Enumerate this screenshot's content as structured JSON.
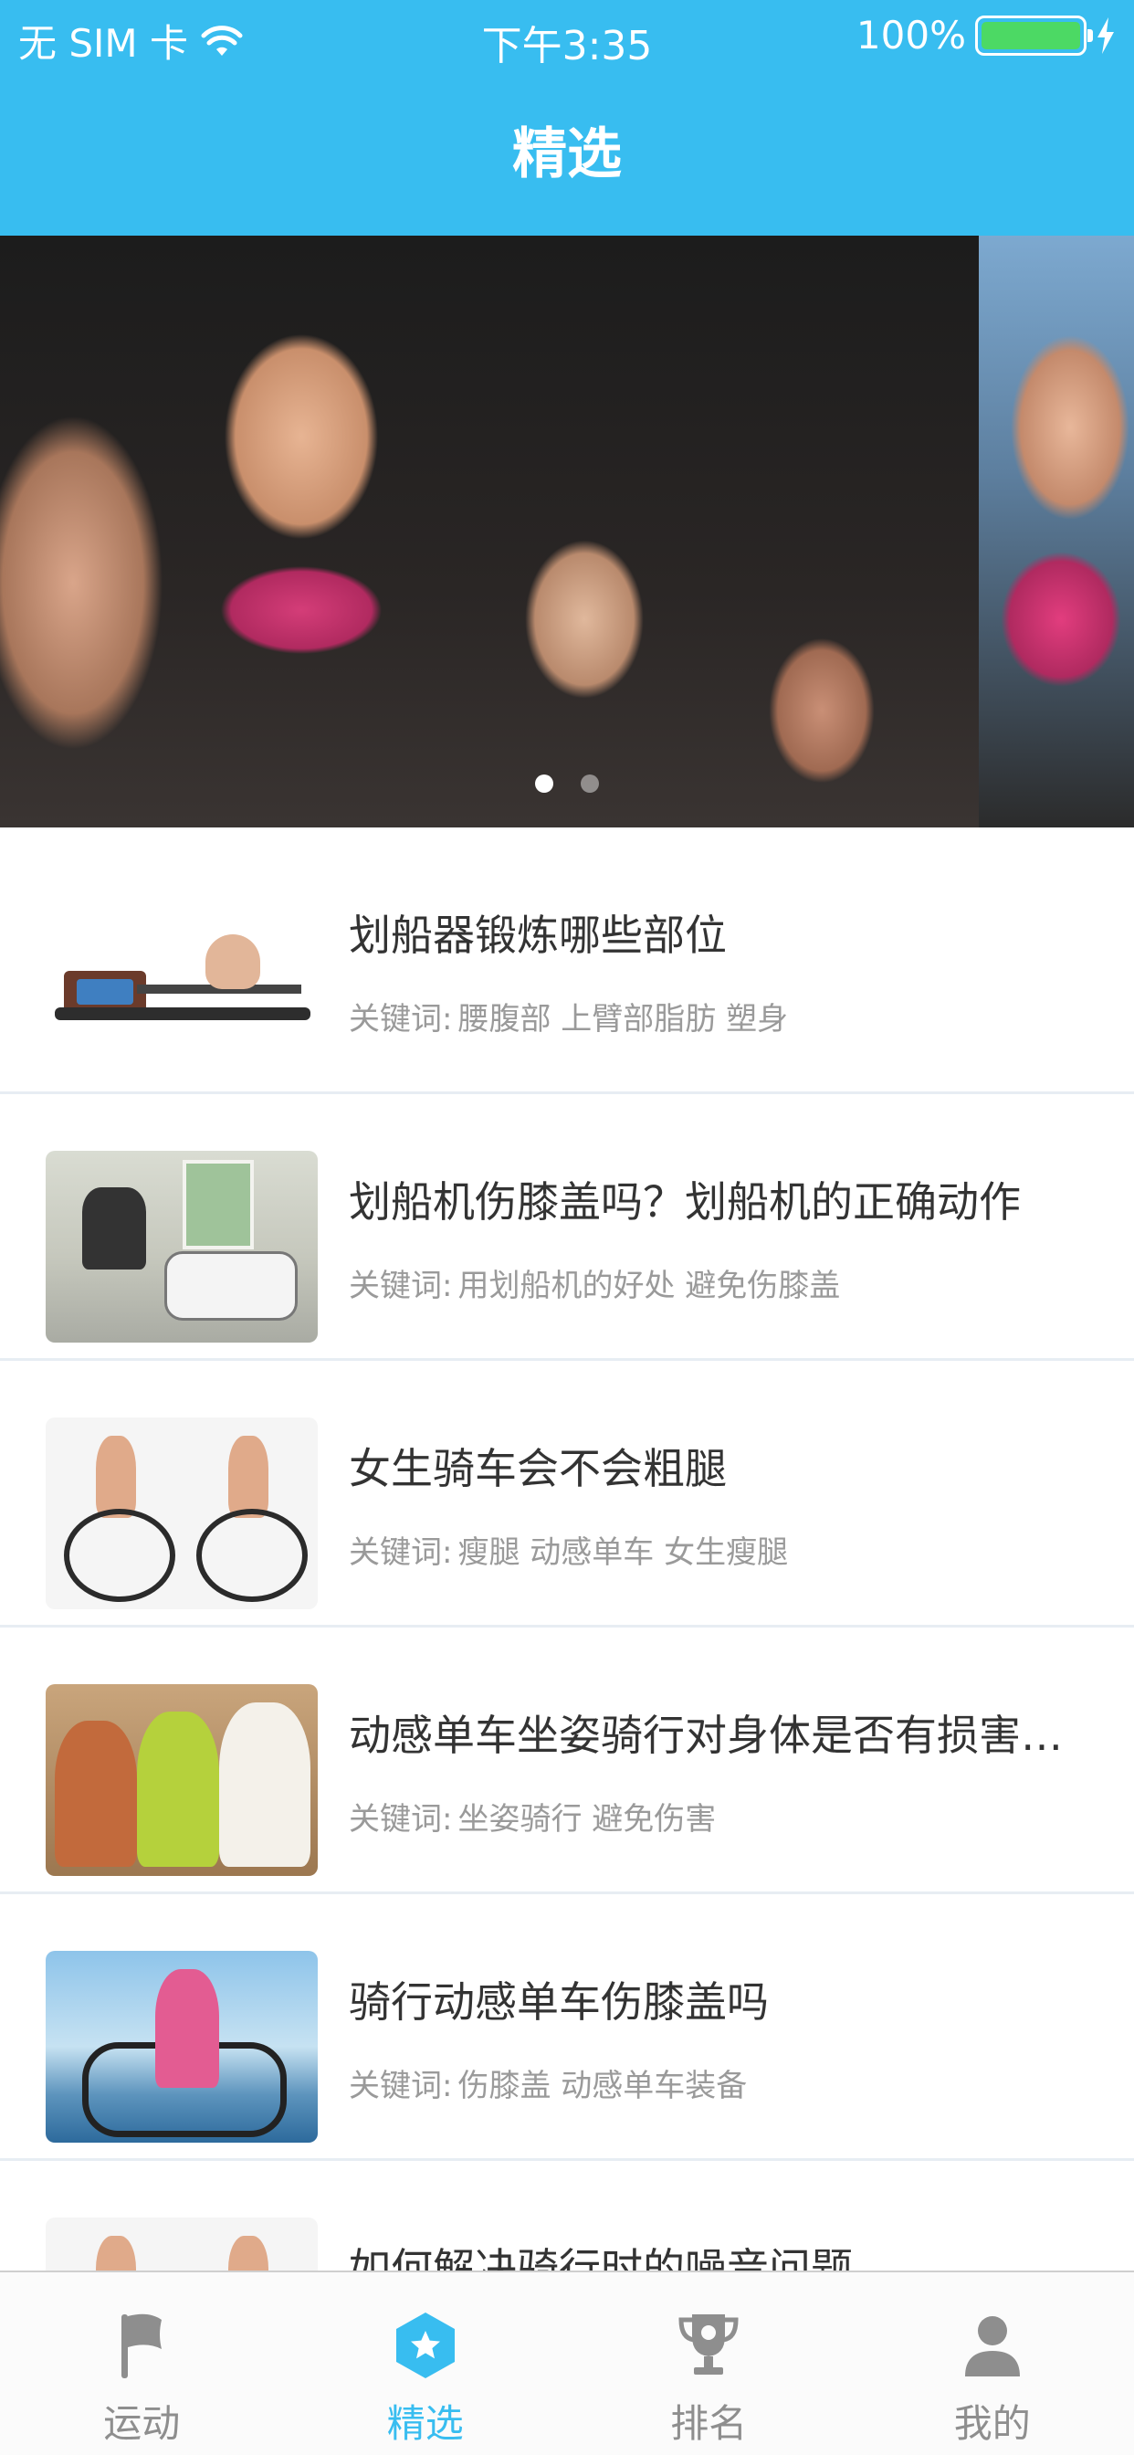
{
  "status_bar": {
    "carrier": "无 SIM 卡",
    "time": "下午3:35",
    "battery_percent": "100%"
  },
  "nav": {
    "title": "精选"
  },
  "banner": {
    "slide_count": 2,
    "active_index": 0
  },
  "articles": [
    {
      "title": "划船器锻炼哪些部位",
      "keywords_label": "关键词:",
      "keywords": "腰腹部 上臂部脂肪 塑身"
    },
    {
      "title": "划船机伤膝盖吗？划船机的正确动作",
      "keywords_label": "关键词:",
      "keywords": "用划船机的好处 避免伤膝盖"
    },
    {
      "title": "女生骑车会不会粗腿",
      "keywords_label": "关键词:",
      "keywords": "瘦腿 动感单车 女生瘦腿"
    },
    {
      "title": "动感单车坐姿骑行对身体是否有损害？...",
      "keywords_label": "关键词:",
      "keywords": "坐姿骑行 避免伤害"
    },
    {
      "title": "骑行动感单车伤膝盖吗",
      "keywords_label": "关键词:",
      "keywords": "伤膝盖 动感单车装备"
    },
    {
      "title": "如何解决骑行时的噪音问题",
      "keywords_label": "",
      "keywords": ""
    }
  ],
  "tabbar": {
    "tabs": [
      {
        "label": "运动",
        "icon": "flag-icon"
      },
      {
        "label": "精选",
        "icon": "star-badge-icon"
      },
      {
        "label": "排名",
        "icon": "trophy-icon"
      },
      {
        "label": "我的",
        "icon": "person-icon"
      }
    ],
    "active_index": 1
  },
  "colors": {
    "accent": "#38bdf0",
    "tab_inactive": "#8e8e8e",
    "battery": "#4cd964"
  }
}
